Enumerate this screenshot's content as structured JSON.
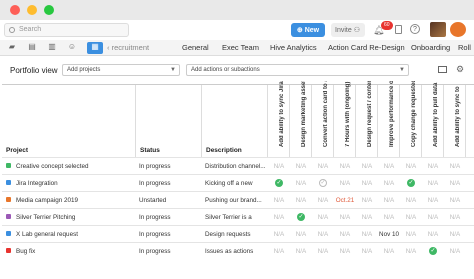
{
  "topbar": {
    "search_placeholder": "Search",
    "new_label": "New",
    "invite_label": "Invite",
    "notification_count": "60"
  },
  "tabs": {
    "views": [
      "folder",
      "card",
      "timeline",
      "people",
      "table"
    ],
    "items": [
      "recruitment",
      "General",
      "Exec Team",
      "Hive Analytics",
      "Action Card Re-Design",
      "Onboarding",
      "Roll"
    ]
  },
  "portfolio": {
    "title": "Portfolio view",
    "projects_dropdown": "Add projects",
    "actions_dropdown": "Add actions or subactions"
  },
  "table": {
    "headers": {
      "project": "Project",
      "status": "Status",
      "description": "Description"
    },
    "columns": [
      "Add ability to sync Jira",
      "Design marketing assets",
      "Convert action card to at",
      "7 Hours with (ongoing)",
      "Design request / content",
      "Improve performance on",
      "Copy change requested",
      "Add ability to pull data",
      "Add ability to sync to"
    ],
    "rows": [
      {
        "project": "Creative concept selected",
        "color": "#3fb865",
        "status": "In progress",
        "description": "Distribution channel...",
        "cells": [
          "N/A",
          "N/A",
          "N/A",
          "N/A",
          "N/A",
          "N/A",
          "N/A",
          "N/A",
          "N/A"
        ]
      },
      {
        "project": "Jira Integration",
        "color": "#3b8fe0",
        "status": "In progress",
        "description": "Kicking off a new",
        "cells": [
          "check",
          "N/A",
          "check-grey",
          "N/A",
          "N/A",
          "N/A",
          "check",
          "N/A",
          "N/A"
        ]
      },
      {
        "project": "Media campaign 2019",
        "color": "#e8762b",
        "status": "Unstarted",
        "description": "Pushing our brand...",
        "cells": [
          "N/A",
          "N/A",
          "N/A",
          "Oct.21",
          "N/A",
          "N/A",
          "N/A",
          "N/A",
          "N/A"
        ]
      },
      {
        "project": "Silver Terrier Pitching",
        "color": "#9b59b6",
        "status": "In progress",
        "description": "Silver Terrier is a",
        "cells": [
          "N/A",
          "check",
          "N/A",
          "N/A",
          "N/A",
          "N/A",
          "N/A",
          "N/A",
          "N/A"
        ]
      },
      {
        "project": "X Lab general request",
        "color": "#3b8fe0",
        "status": "In progress",
        "description": "Design requests",
        "cells": [
          "N/A",
          "N/A",
          "N/A",
          "N/A",
          "N/A",
          "Nov 10",
          "N/A",
          "N/A",
          "N/A"
        ]
      },
      {
        "project": "Bug fix",
        "color": "#e8332f",
        "status": "In progress",
        "description": "Issues as actions",
        "cells": [
          "N/A",
          "N/A",
          "N/A",
          "N/A",
          "N/A",
          "N/A",
          "N/A",
          "check",
          "N/A"
        ]
      }
    ]
  }
}
